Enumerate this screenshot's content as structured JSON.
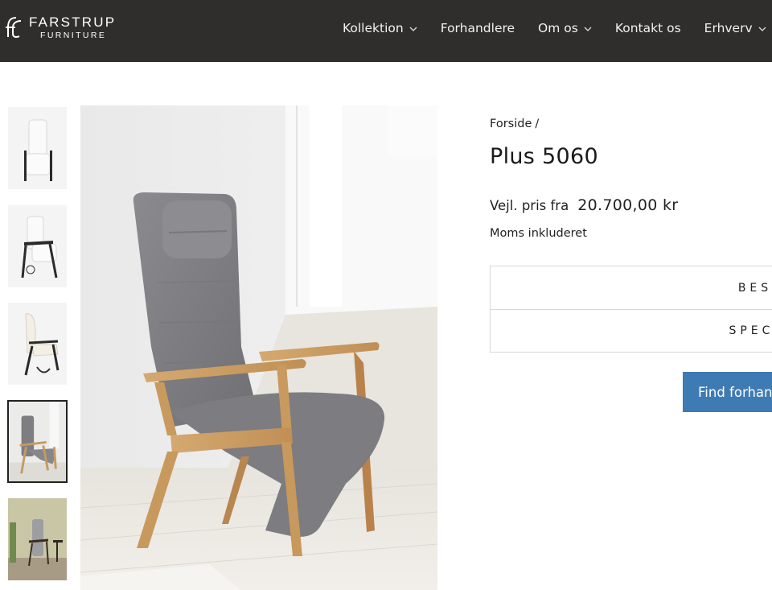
{
  "brand": {
    "line1": "FARSTRUP",
    "line2": "FURNITURE"
  },
  "nav": {
    "items": [
      {
        "label": "Kollektion",
        "has_dropdown": true
      },
      {
        "label": "Forhandlere",
        "has_dropdown": false
      },
      {
        "label": "Om os",
        "has_dropdown": true
      },
      {
        "label": "Kontakt os",
        "has_dropdown": false
      },
      {
        "label": "Erhverv",
        "has_dropdown": true
      }
    ]
  },
  "breadcrumb": {
    "home": "Forside",
    "separator": "/"
  },
  "product": {
    "title": "Plus 5060",
    "price_label": "Vejl. pris fra",
    "price": "20.700,00 kr",
    "vat_note": "Moms inkluderet"
  },
  "accordion": {
    "items": [
      "BES",
      "SPECI"
    ]
  },
  "cta": {
    "label": "Find forhan"
  },
  "gallery": {
    "thumbnail_count": 5,
    "active_index": 3
  },
  "colors": {
    "header_bg": "#2f2e2c",
    "cta_bg": "#3e7bb3",
    "border": "#d8d8d8"
  }
}
